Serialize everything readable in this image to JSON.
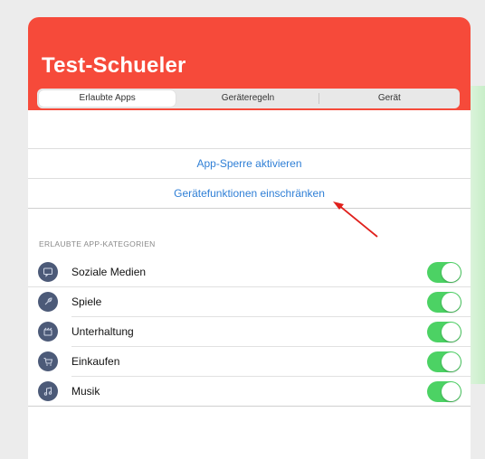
{
  "header": {
    "title": "Test-Schueler",
    "color": "#f64a3a"
  },
  "tabs": [
    {
      "label": "Erlaubte Apps",
      "active": true
    },
    {
      "label": "Geräteregeln",
      "active": false
    },
    {
      "label": "Gerät",
      "active": false
    }
  ],
  "actions": {
    "app_lock": "App-Sperre aktivieren",
    "restrict": "Gerätefunktionen einschränken"
  },
  "categories": {
    "section_label": "ERLAUBTE APP-KATEGORIEN",
    "items": [
      {
        "label": "Soziale Medien",
        "icon": "chat-icon",
        "enabled": true
      },
      {
        "label": "Spiele",
        "icon": "rocket-icon",
        "enabled": true
      },
      {
        "label": "Unterhaltung",
        "icon": "film-icon",
        "enabled": true
      },
      {
        "label": "Einkaufen",
        "icon": "cart-icon",
        "enabled": true
      },
      {
        "label": "Musik",
        "icon": "music-icon",
        "enabled": true
      }
    ]
  },
  "accent": {
    "link": "#2f7fd6",
    "toggle_on": "#4cd264",
    "annotation_arrow": "#e0201c"
  }
}
